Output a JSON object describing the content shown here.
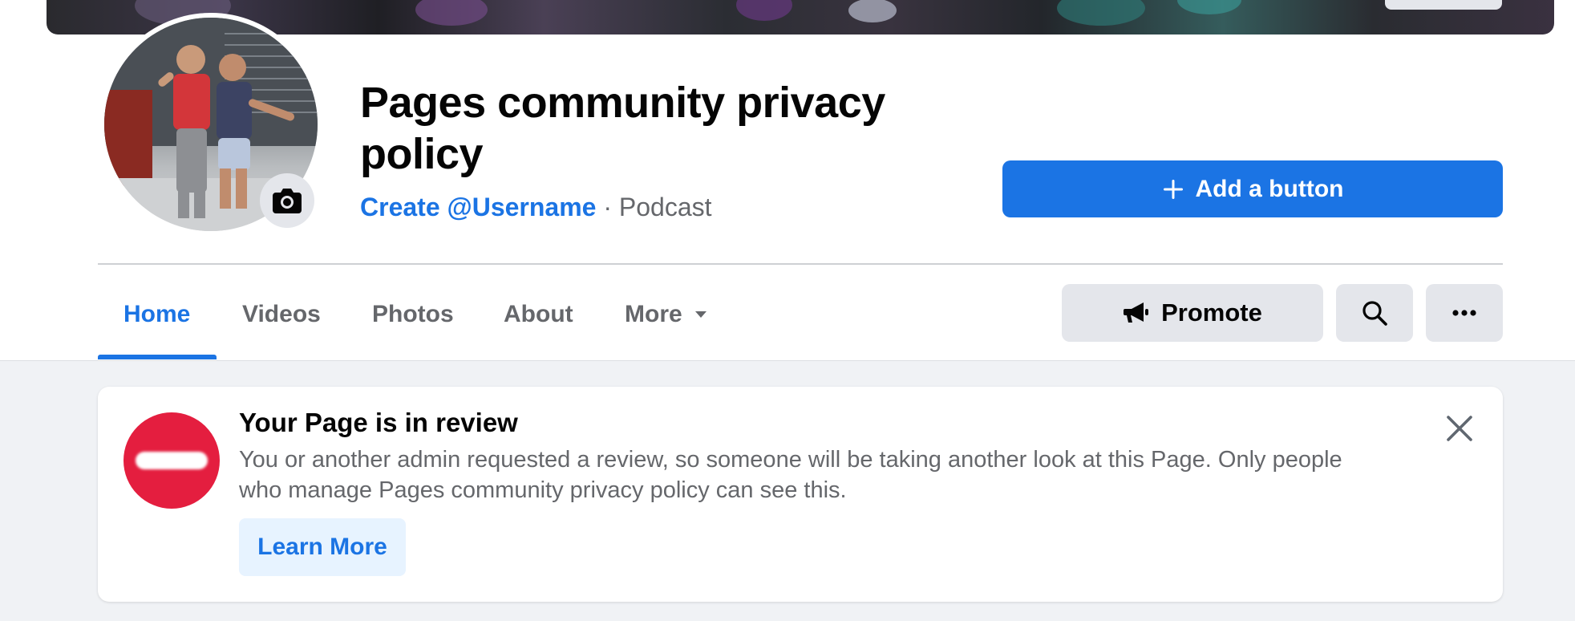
{
  "page": {
    "title": "Pages community privacy policy",
    "username_link": "Create @Username",
    "separator": " · ",
    "category": "Podcast"
  },
  "actions": {
    "add_button_label": "Add a button",
    "promote_label": "Promote"
  },
  "tabs": [
    {
      "label": "Home",
      "active": true
    },
    {
      "label": "Videos",
      "active": false
    },
    {
      "label": "Photos",
      "active": false
    },
    {
      "label": "About",
      "active": false
    },
    {
      "label": "More",
      "active": false
    }
  ],
  "review_notice": {
    "title": "Your Page is in review",
    "body": "You or another admin requested a review, so someone will be taking another look at this Page. Only people who manage Pages community privacy policy can see this.",
    "button_label": "Learn More"
  },
  "icons": {
    "profile_camera": "camera-icon",
    "add": "plus-icon",
    "more_tab": "caret-down-icon",
    "promote": "megaphone-icon",
    "search": "search-icon",
    "more_actions": "ellipsis-icon",
    "notice": "stop-sign-icon",
    "close": "close-icon"
  },
  "colors": {
    "accent": "#1b74e4",
    "notice_red": "#e41e3f",
    "background": "#f0f2f5",
    "button_gray": "#e4e6eb"
  }
}
